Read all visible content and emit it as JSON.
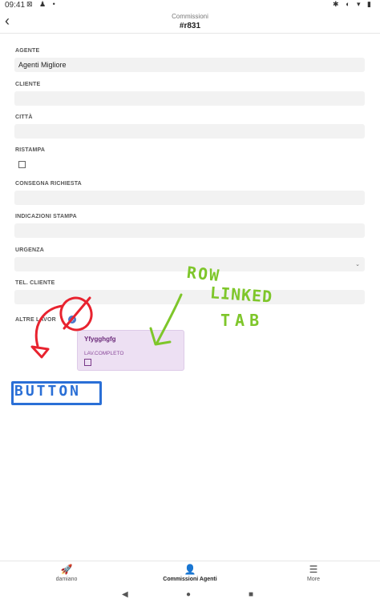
{
  "status_bar": {
    "time": "09:41",
    "left_icons": "⊠ ♟ •",
    "right_icons": "✱ ◐ ▾ ▮"
  },
  "header": {
    "back_glyph": "‹",
    "subtitle": "Commissioni",
    "title": "#r831"
  },
  "form": {
    "agente": {
      "label": "AGENTE",
      "value": "Agenti Migliore"
    },
    "cliente": {
      "label": "CLIENTE",
      "value": ""
    },
    "citta": {
      "label": "CITTÀ",
      "value": ""
    },
    "ristampa": {
      "label": "RISTAMPA",
      "checked": false
    },
    "consegna": {
      "label": "CONSEGNA RICHIESTA",
      "value": ""
    },
    "indicazioni": {
      "label": "INDICAZIONI STAMPA",
      "value": ""
    },
    "urgenza": {
      "label": "URGENZA",
      "value": "",
      "chevron": "⌄"
    },
    "tel_cliente": {
      "label": "TEL. CLIENTE",
      "value": ""
    },
    "altre_lavorazioni": {
      "label": "ALTRE LAVOR",
      "add_glyph": "+"
    }
  },
  "linked_card": {
    "title": "Yfygghgfg",
    "field_label": "LAV.COMPLETO",
    "checked": false
  },
  "annotations": {
    "row": "ROW",
    "linked": "LINKED",
    "tab": "TAB",
    "button": "BUTTON",
    "green_color": "#7ec62a",
    "red_color": "#e8232f",
    "blue_color": "#2a6fd6"
  },
  "bottom_nav": {
    "items": [
      {
        "label": "damiano",
        "icon": "🚀"
      },
      {
        "label": "Commissioni Agenti",
        "icon": "👤"
      },
      {
        "label": "More",
        "icon": "☰"
      }
    ]
  },
  "system_nav": {
    "back": "◀",
    "home": "●",
    "recents": "■"
  }
}
